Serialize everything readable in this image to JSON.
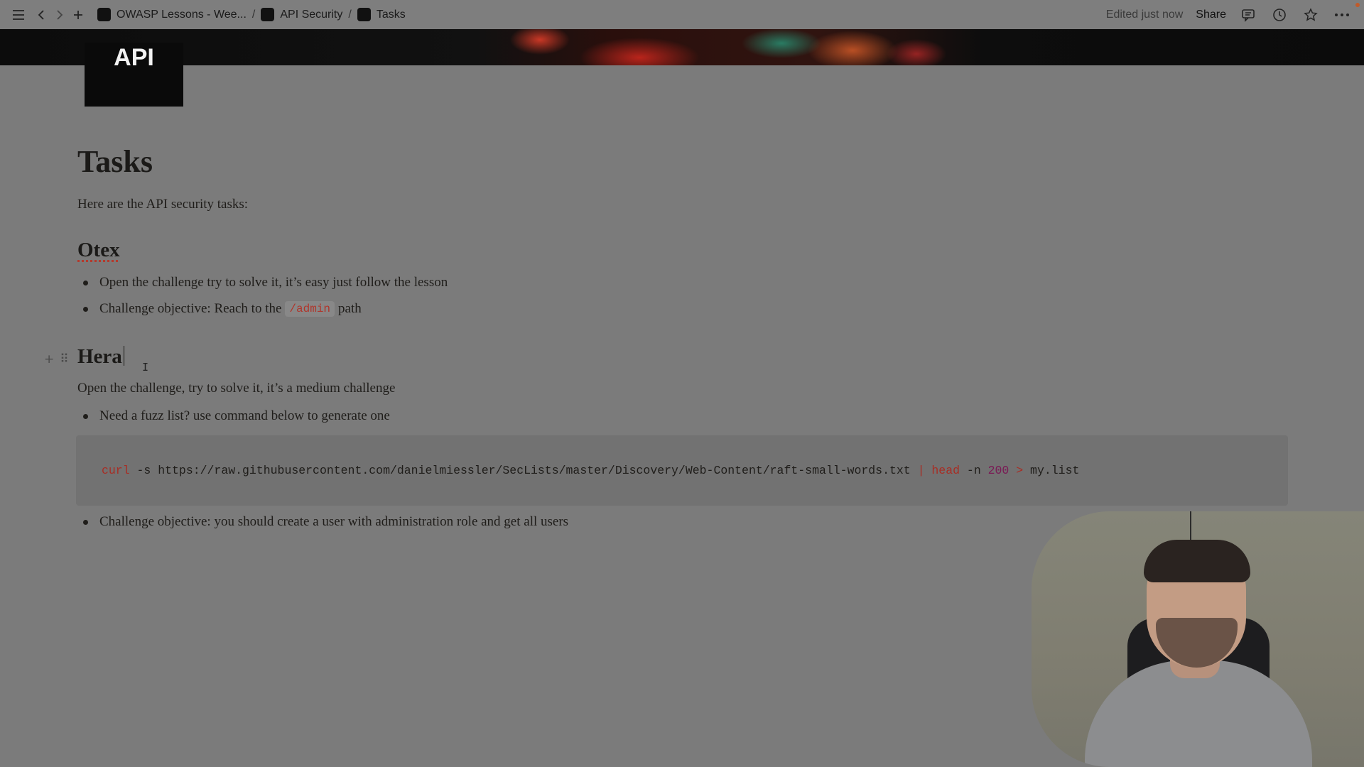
{
  "topbar": {
    "breadcrumbs": [
      {
        "label": "OWASP Lessons - Wee..."
      },
      {
        "label": "API Security"
      },
      {
        "label": "Tasks"
      }
    ],
    "edited": "Edited just now",
    "share": "Share"
  },
  "cover": {
    "logo_text": "API"
  },
  "page": {
    "title": "Tasks",
    "intro": "Here are the API security tasks:",
    "sections": [
      {
        "heading": "Otex",
        "bullets": [
          "Open the challenge try to solve it, it’s easy just follow the lesson"
        ],
        "objective_prefix": "Challenge objective: Reach to the",
        "objective_code": "/admin",
        "objective_suffix": "path"
      },
      {
        "heading": "Hera",
        "description": "Open the challenge, try to solve it, it’s a medium challenge",
        "bullets": [
          "Need a fuzz list? use command below to generate one",
          "Challenge objective: you should create a user with administration role and get all users"
        ],
        "code": {
          "cmd": "curl",
          "args": " -s https://raw.githubusercontent.com/danielmiessler/SecLists/master/Discovery/Web-Content/raft-small-words.txt ",
          "pipe": "|",
          "cmd2": " head",
          "opt": " -n ",
          "num": "200",
          "redir": " >",
          "out": " my.list"
        }
      }
    ]
  },
  "colors": {
    "code_red": "#a82d24",
    "code_purple": "#7a1a55",
    "overlay_bg": "#7b7b7b"
  },
  "icons": [
    "sidebar-toggle-icon",
    "back-arrow-icon",
    "forward-arrow-icon",
    "plus-icon",
    "comment-icon",
    "history-clock-icon",
    "star-icon",
    "more-icon",
    "drag-handle-icon",
    "text-cursor-icon"
  ]
}
